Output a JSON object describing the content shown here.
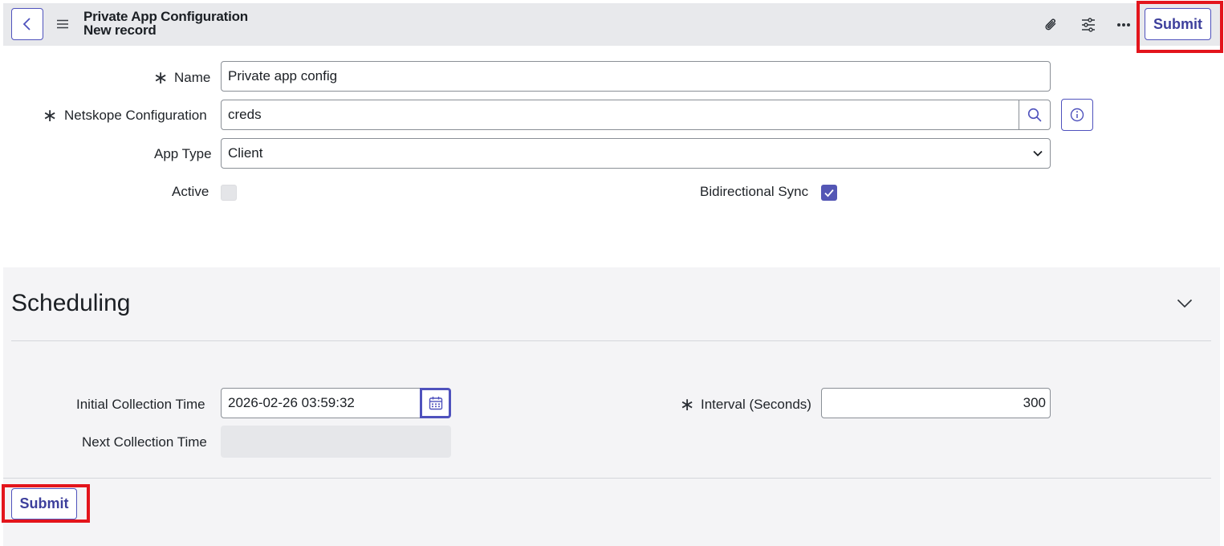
{
  "header": {
    "title": "Private App Configuration",
    "subtitle": "New record",
    "submit_label": "Submit"
  },
  "form": {
    "name": {
      "label": "Name",
      "required": true,
      "value": "Private app config"
    },
    "netskope_configuration": {
      "label": "Netskope Configuration",
      "required": true,
      "value": "creds"
    },
    "app_type": {
      "label": "App Type",
      "value": "Client"
    },
    "active": {
      "label": "Active",
      "checked": false
    },
    "bidirectional_sync": {
      "label": "Bidirectional Sync",
      "checked": true
    }
  },
  "scheduling": {
    "title": "Scheduling",
    "initial_collection_time": {
      "label": "Initial Collection Time",
      "value": "2026-02-26 03:59:32"
    },
    "next_collection_time": {
      "label": "Next Collection Time",
      "value": ""
    },
    "interval": {
      "label": "Interval (Seconds)",
      "required": true,
      "value": "300"
    }
  },
  "footer": {
    "submit_label": "Submit"
  },
  "icons": {
    "back": "chevron-left-icon",
    "menu": "hamburger-menu-icon",
    "attachment": "paperclip-icon",
    "personalize": "sliders-icon",
    "more": "ellipsis-icon",
    "search": "search-icon",
    "info": "info-icon",
    "dropdown": "chevron-down-icon",
    "calendar": "calendar-icon",
    "collapse": "chevron-down-icon"
  },
  "colors": {
    "accent": "#4f52bd",
    "highlight": "#e3151c",
    "header_bg": "#e8e9ec",
    "section_bg": "#f4f4f6",
    "checkbox_checked": "#5457b5",
    "checkbox_unchecked": "#e4e5e8",
    "readonly_bg": "#e6e7ea"
  }
}
